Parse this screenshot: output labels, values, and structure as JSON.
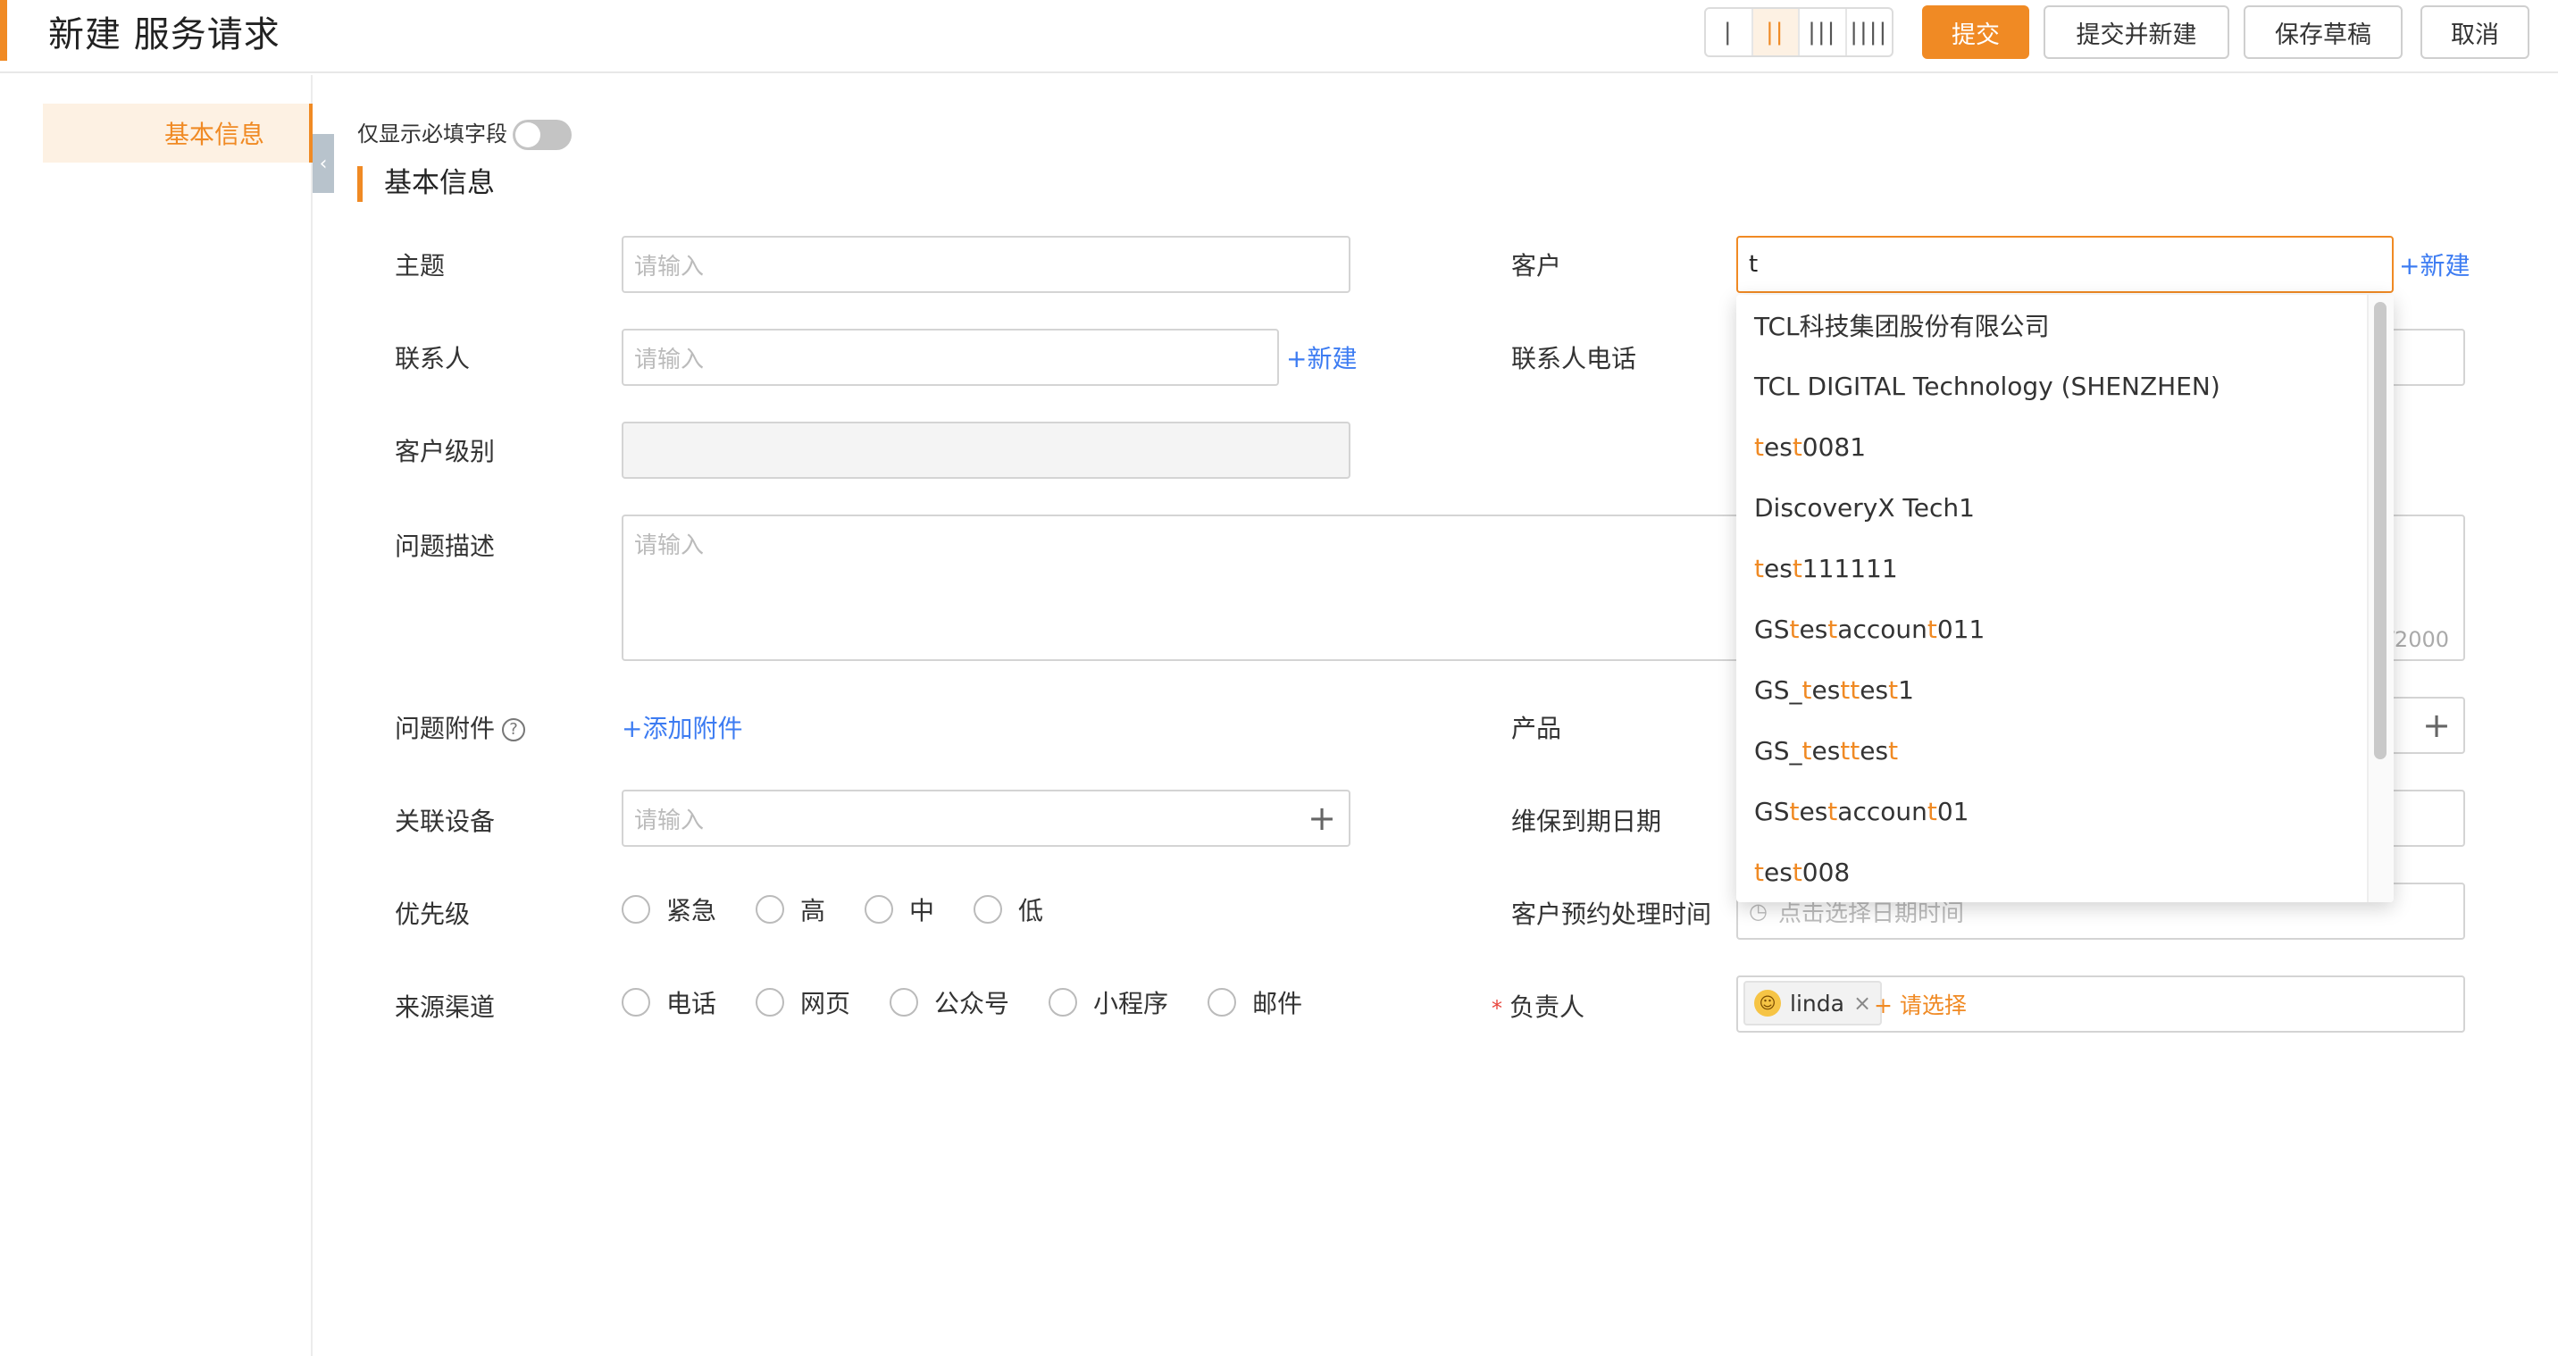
{
  "header": {
    "title": "新建 服务请求",
    "layout_options": [
      "|",
      "||",
      "|||",
      "||||"
    ],
    "active_layout_index": 1,
    "buttons": {
      "submit": "提交",
      "submit_new": "提交并新建",
      "save_draft": "保存草稿",
      "cancel": "取消"
    }
  },
  "sidebar": {
    "items": [
      {
        "label": "基本信息",
        "active": true
      }
    ],
    "collapse_glyph": "‹"
  },
  "form": {
    "only_required_label": "仅显示必填字段",
    "only_required_on": false,
    "section_title": "基本信息",
    "placeholder": "请输入",
    "datetime_placeholder": "点击选择日期时间",
    "new_link": "+新建",
    "add_attachment": "+添加附件",
    "select_link": "+ 请选择",
    "char_count": "0/2000",
    "fields": {
      "subject": "主题",
      "contact": "联系人",
      "customer_level": "客户级别",
      "description": "问题描述",
      "attachment": "问题附件",
      "related_device": "关联设备",
      "priority": "优先级",
      "source": "来源渠道",
      "customer": "客户",
      "contact_phone": "联系人电话",
      "product": "产品",
      "warranty_date": "维保到期日期",
      "appointment_time": "客户预约处理时间",
      "owner": "负责人"
    },
    "customer_value": "t",
    "priority_options": [
      "紧急",
      "高",
      "中",
      "低"
    ],
    "source_options": [
      "电话",
      "网页",
      "公众号",
      "小程序",
      "邮件"
    ],
    "owner_tag": "linda"
  },
  "dropdown": {
    "options": [
      {
        "parts": [
          {
            "t": "TCL科技集团股份有限公司",
            "h": false
          }
        ]
      },
      {
        "parts": [
          {
            "t": "TCL DIGITAL Technology (SHENZHEN)",
            "h": false
          }
        ]
      },
      {
        "parts": [
          {
            "t": "t",
            "h": true
          },
          {
            "t": "es",
            "h": false
          },
          {
            "t": "t",
            "h": true
          },
          {
            "t": "0081",
            "h": false
          }
        ]
      },
      {
        "parts": [
          {
            "t": "DiscoveryX Tech1",
            "h": false
          }
        ]
      },
      {
        "parts": [
          {
            "t": "t",
            "h": true
          },
          {
            "t": "es",
            "h": false
          },
          {
            "t": "t",
            "h": true
          },
          {
            "t": "111111",
            "h": false
          }
        ]
      },
      {
        "parts": [
          {
            "t": "GS ",
            "h": false
          },
          {
            "t": "t",
            "h": true
          },
          {
            "t": "es",
            "h": false
          },
          {
            "t": "t",
            "h": true
          },
          {
            "t": " accoun",
            "h": false
          },
          {
            "t": "t",
            "h": true
          },
          {
            "t": " 011",
            "h": false
          }
        ]
      },
      {
        "parts": [
          {
            "t": "GS_",
            "h": false
          },
          {
            "t": "t",
            "h": true
          },
          {
            "t": "es",
            "h": false
          },
          {
            "t": "t",
            "h": true
          },
          {
            "t": "t",
            "h": true
          },
          {
            "t": "es",
            "h": false
          },
          {
            "t": "t",
            "h": true
          },
          {
            "t": "1",
            "h": false
          }
        ]
      },
      {
        "parts": [
          {
            "t": "GS_",
            "h": false
          },
          {
            "t": "t",
            "h": true
          },
          {
            "t": "es",
            "h": false
          },
          {
            "t": "t",
            "h": true
          },
          {
            "t": "t",
            "h": true
          },
          {
            "t": "es",
            "h": false
          },
          {
            "t": "t",
            "h": true
          }
        ]
      },
      {
        "parts": [
          {
            "t": "GS ",
            "h": false
          },
          {
            "t": "t",
            "h": true
          },
          {
            "t": "es",
            "h": false
          },
          {
            "t": "t",
            "h": true
          },
          {
            "t": " accoun",
            "h": false
          },
          {
            "t": "t",
            "h": true
          },
          {
            "t": " 01",
            "h": false
          }
        ]
      },
      {
        "parts": [
          {
            "t": "t",
            "h": true
          },
          {
            "t": "es",
            "h": false
          },
          {
            "t": "t",
            "h": true
          },
          {
            "t": "008",
            "h": false
          }
        ]
      }
    ]
  },
  "colors": {
    "accent": "#f08a24",
    "link": "#3d7cf2",
    "required": "#e8453c"
  },
  "icons": {
    "help": "question-circle-icon",
    "plus": "plus-icon",
    "clock": "clock-icon",
    "close": "close-icon",
    "avatar": "user-avatar-icon"
  }
}
